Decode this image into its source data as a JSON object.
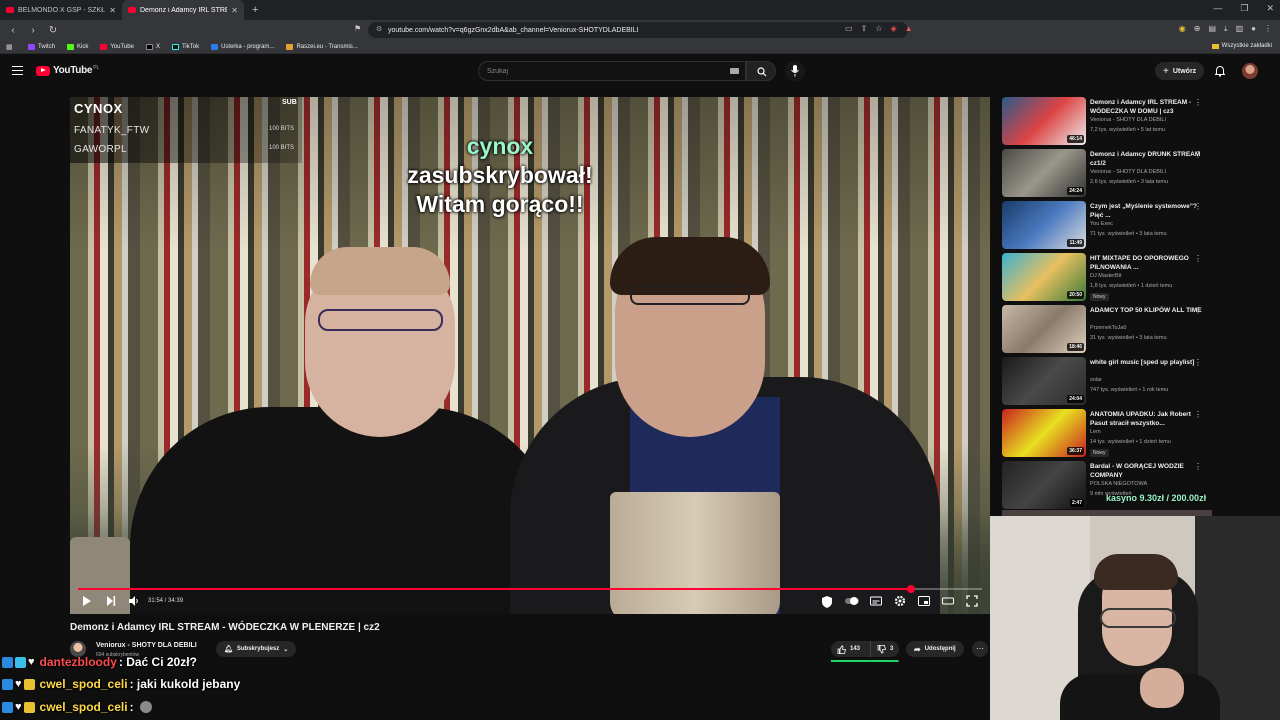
{
  "browser": {
    "tabs": [
      {
        "label": "BELMONDO X GSP - SZKŁO - YouTube",
        "active": false
      },
      {
        "label": "Demonz i Adamcy IRL STREAM",
        "active": true
      }
    ],
    "url": "youtube.com/watch?v=q6gzGnx2dbA&ab_channel=Veniorux-SHOTYDLADEBILI",
    "bookmarks": [
      "Twitch",
      "Kick",
      "YouTube",
      "X",
      "TikTok",
      "Usterka - program...",
      "Raszei.eu - Transmis..."
    ],
    "bookmarks_folder": "Wszystkie zakładki"
  },
  "yt": {
    "logo_text": "YouTube",
    "logo_region": "PL",
    "search_placeholder": "Szukaj",
    "create_label": "Utwórz"
  },
  "overlay": {
    "sub_title": "CYNOX",
    "sub_label": "SUB",
    "rows": [
      {
        "name": "FANATYK_FTW",
        "bits": "100 BITS"
      },
      {
        "name": "GAWORPL",
        "bits": "100 BITS"
      }
    ],
    "alert_name": "cynox",
    "alert_line1": "zasubskrybował!",
    "alert_line2": "Witam gorąco!!"
  },
  "player": {
    "time": "31:54 / 34:39",
    "progress_fraction": 0.921
  },
  "video": {
    "title": "Demonz i Adamcy IRL STREAM - WÓDECZKA W PLENERZE | cz2",
    "channel_name": "Veniorux - SHOTY DLA DEBILI",
    "channel_subs": "694 subskrybentów",
    "subscribe_label": "Subskrybujesz",
    "likes": "143",
    "dislikes": "3",
    "like_ratio": 0.98,
    "share_label": "Udostępnij"
  },
  "chat": [
    {
      "user": "dantezbloody",
      "msg": ": Dać Ci 20zł?",
      "color": "#ff4c4c"
    },
    {
      "user": "cwel_spod_celi",
      "msg": ": jaki kukold jebany",
      "color": "#ffd84a"
    },
    {
      "user": "cwel_spod_celi",
      "msg": ":",
      "color": "#ffd84a"
    }
  ],
  "recs": [
    {
      "title": "Demonz i Adamcy IRL STREAM - WÓDECZKA W DOMU | cz3",
      "channel": "Veniorux - SHOTY DLA DEBILI",
      "meta": "7,2 tys. wyświetleń • 5 lat temu",
      "duration": "46:14",
      "new": "",
      "thumb": "linear-gradient(135deg,#2a5a8a,#d44,#eee)"
    },
    {
      "title": "Demonz i Adamcy DRUNK STREAM cz1/2",
      "channel": "Veniorux - SHOTY DLA DEBILI",
      "meta": "2,6 tys. wyświetleń • 3 lata temu",
      "duration": "24:24",
      "new": "",
      "thumb": "linear-gradient(135deg,#4a4a46,#9a968a,#333)"
    },
    {
      "title": "Czym jest „Myślenie systemowe”? Pięć ...",
      "channel": "You Exec",
      "meta": "71 tys. wyświetleń • 3 lata temu",
      "duration": "11:49",
      "new": "",
      "thumb": "linear-gradient(135deg,#1a3a6a,#4a7ac0,#ddd)"
    },
    {
      "title": "HIT MIXTAPE DO OPOROWEGO PILNOWANIA ...",
      "channel": "DJ MasterBit",
      "meta": "1,8 tys. wyświetleń • 1 dzień temu",
      "duration": "20:50",
      "new": "Nowy",
      "thumb": "linear-gradient(135deg,#3ab0d0,#e8c060,#3a7a3a)"
    },
    {
      "title": "ADAMCY TOP 50 KLIPÓW ALL TIME",
      "channel": "PrzemekToJa0",
      "meta": "31 tys. wyświetleń • 3 lata temu",
      "duration": "18:46",
      "new": "",
      "thumb": "linear-gradient(135deg,#c8b8a8,#8a7a6a,#e0d0c0)"
    },
    {
      "title": "white girl music [sped up playlist]",
      "channel": "solar",
      "meta": "747 tys. wyświetleń • 1 rok temu",
      "duration": "24:04",
      "new": "",
      "thumb": "linear-gradient(135deg,#1a1a1a,#4a4a4a,#2a2a2a)"
    },
    {
      "title": "ANATOMIA UPADKU: Jak Robert Pasut stracił wszystko...",
      "channel": "Lem",
      "meta": "14 tys. wyświetleń • 1 dzień temu",
      "duration": "36:37",
      "new": "Nowy",
      "thumb": "linear-gradient(135deg,#c82020,#e8e020,#c82020)"
    },
    {
      "title": "Bardal - W GORĄCEJ WODZIE COMPANY",
      "channel": "POLSKA NIEGOTOWA",
      "meta": "9 mln wyświetleń",
      "duration": "2:47",
      "new": "",
      "thumb": "linear-gradient(135deg,#222,#444,#111)"
    }
  ],
  "donation": "kasyno 9.30zł / 200.00zł",
  "colors": {
    "accent": "#ff0033",
    "alert": "#9af5c9"
  }
}
